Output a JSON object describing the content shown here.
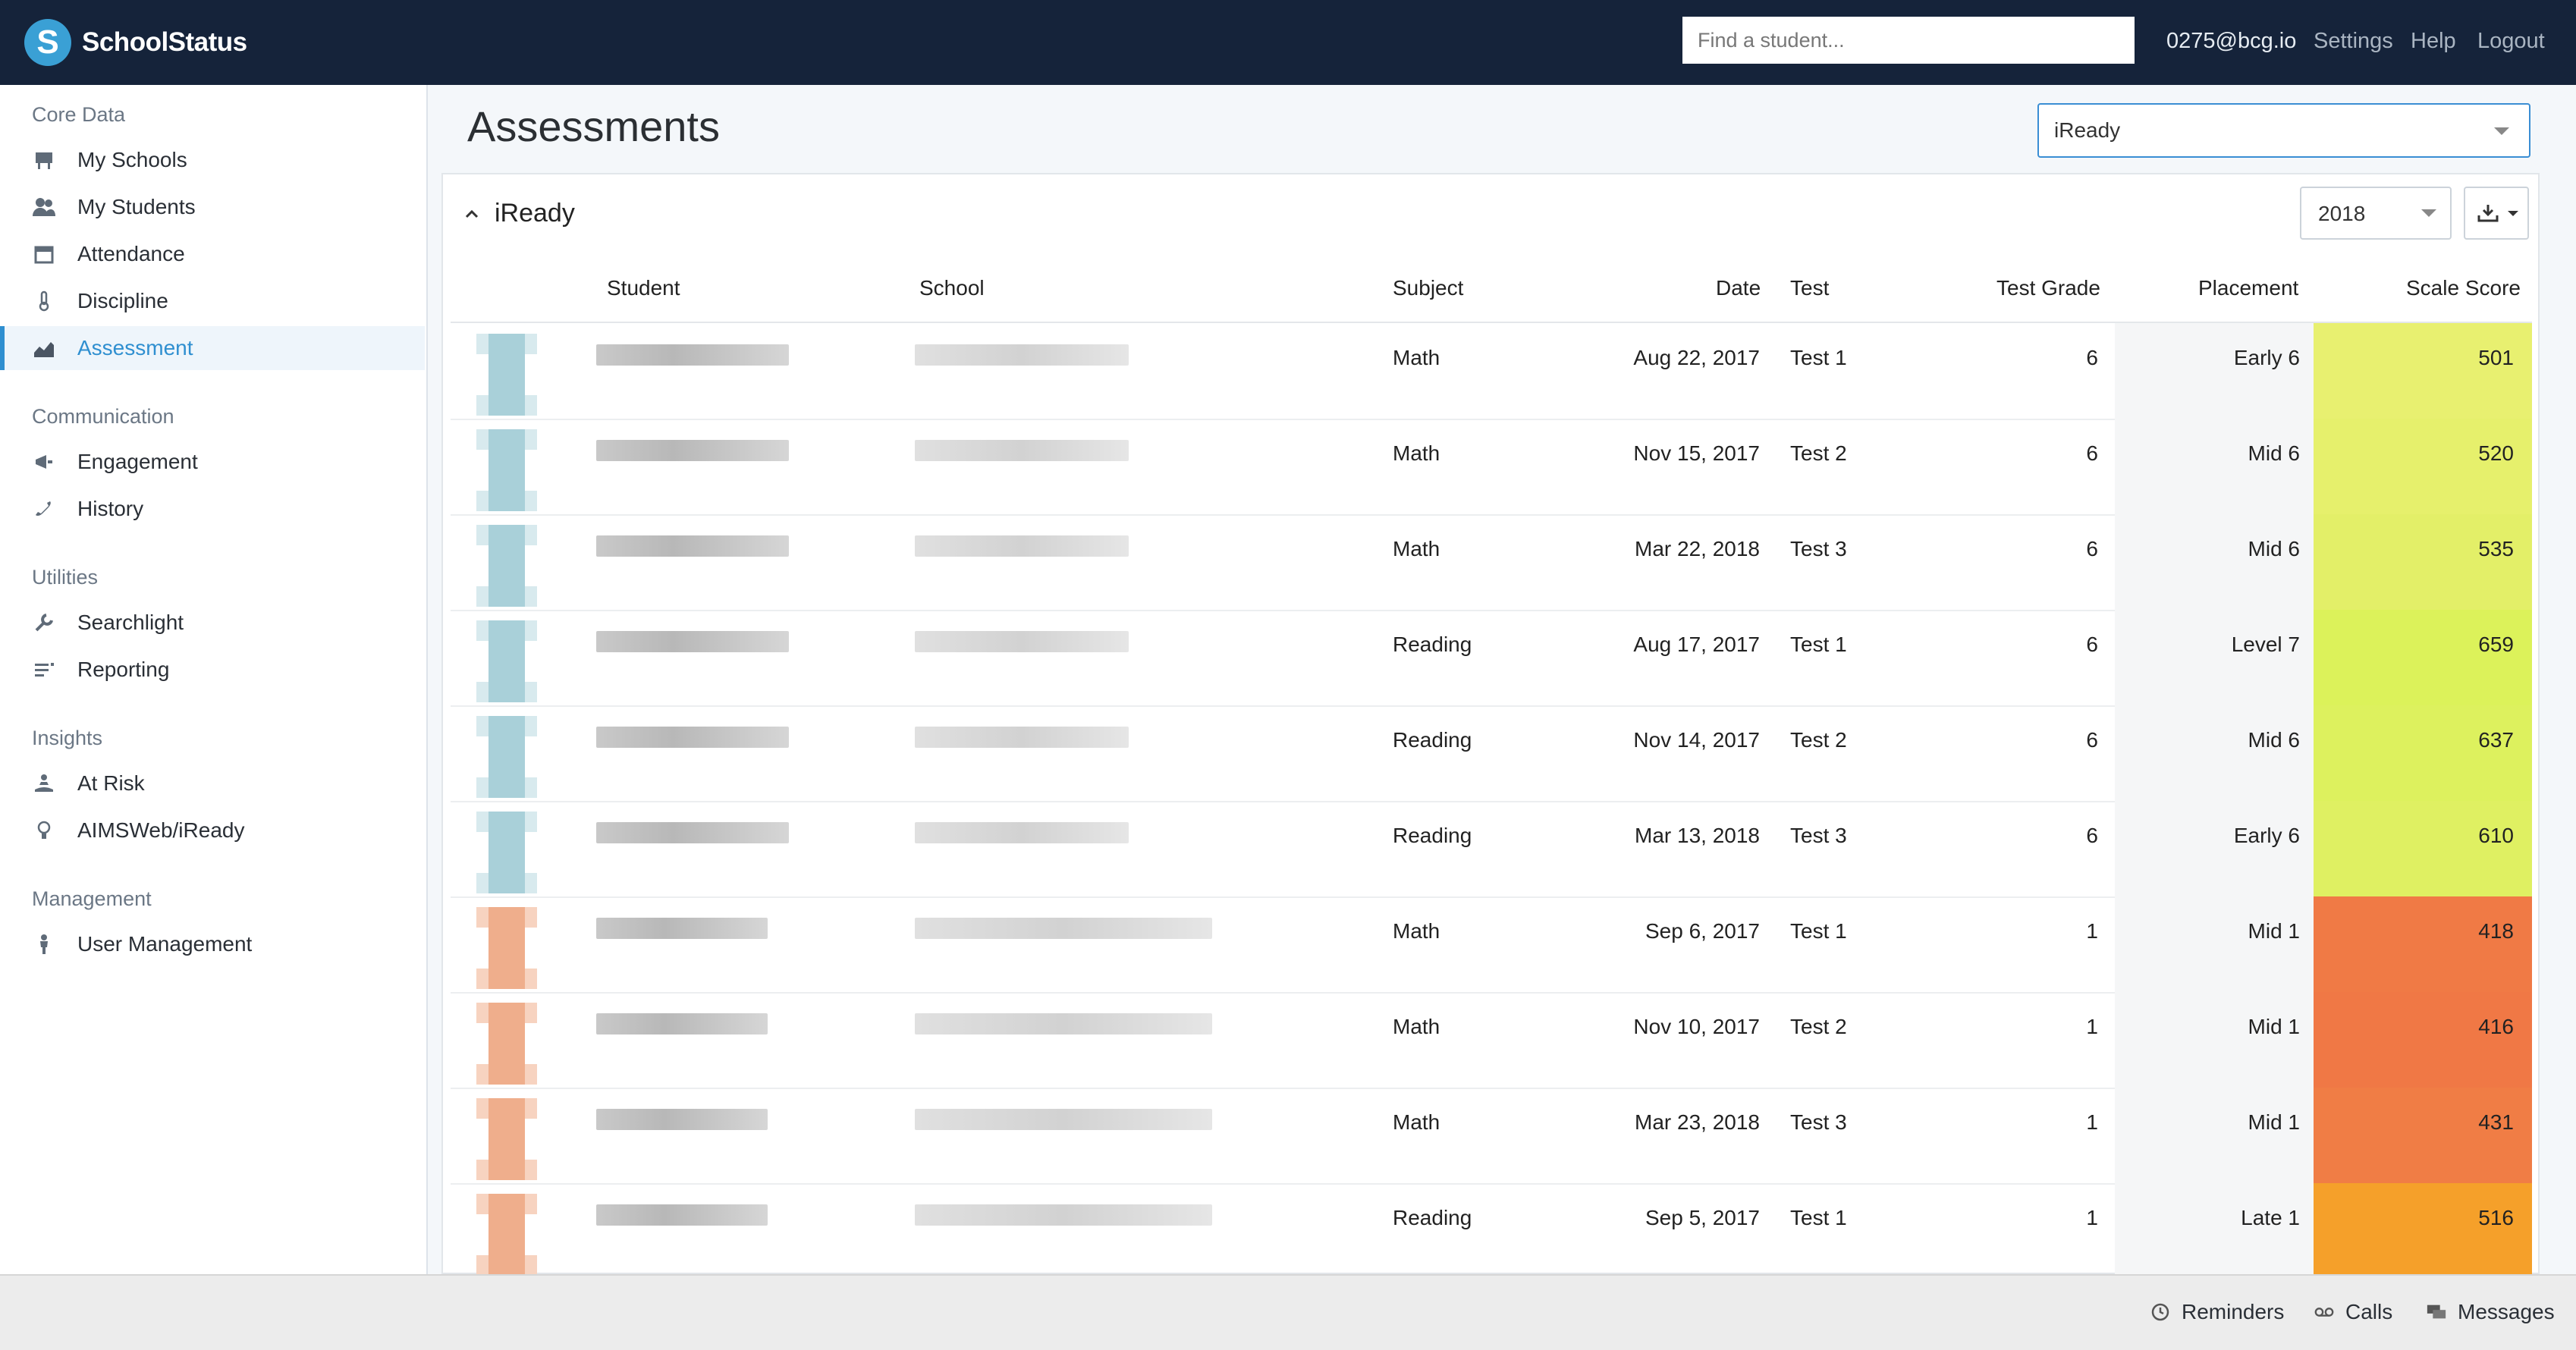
{
  "app": {
    "name": "SchoolStatus",
    "logo_letter": "S"
  },
  "topbar": {
    "search_placeholder": "Find a student...",
    "user": "0275@bcg.io",
    "settings": "Settings",
    "help": "Help",
    "logout": "Logout"
  },
  "sidebar": {
    "sections": [
      {
        "title": "Core Data",
        "items": [
          {
            "label": "My Schools",
            "icon": "school-icon"
          },
          {
            "label": "My Students",
            "icon": "students-icon"
          },
          {
            "label": "Attendance",
            "icon": "calendar-icon"
          },
          {
            "label": "Discipline",
            "icon": "thermometer-icon"
          },
          {
            "label": "Assessment",
            "icon": "chart-icon",
            "active": true
          }
        ]
      },
      {
        "title": "Communication",
        "items": [
          {
            "label": "Engagement",
            "icon": "megaphone-icon"
          },
          {
            "label": "History",
            "icon": "phone-icon"
          }
        ]
      },
      {
        "title": "Utilities",
        "items": [
          {
            "label": "Searchlight",
            "icon": "wrench-icon"
          },
          {
            "label": "Reporting",
            "icon": "list-icon"
          }
        ]
      },
      {
        "title": "Insights",
        "items": [
          {
            "label": "At Risk",
            "icon": "person-icon"
          },
          {
            "label": "AIMSWeb/iReady",
            "icon": "lightbulb-icon"
          }
        ]
      },
      {
        "title": "Management",
        "items": [
          {
            "label": "User Management",
            "icon": "user-icon"
          }
        ]
      }
    ]
  },
  "main": {
    "title": "Assessments",
    "assessment_select": "iReady",
    "panel_title": "iReady",
    "year_select": "2018"
  },
  "table": {
    "columns": [
      "Student",
      "School",
      "Subject",
      "Date",
      "Test",
      "Test Grade",
      "Placement",
      "Scale Score"
    ],
    "rows": [
      {
        "subject": "Math",
        "date": "Aug 22, 2017",
        "test": "Test 1",
        "grade": "6",
        "placement": "Early 6",
        "score": "501",
        "score_color": "#e8f070",
        "tone": "blue"
      },
      {
        "subject": "Math",
        "date": "Nov 15, 2017",
        "test": "Test 2",
        "grade": "6",
        "placement": "Mid 6",
        "score": "520",
        "score_color": "#e6f06c",
        "tone": "blue"
      },
      {
        "subject": "Math",
        "date": "Mar 22, 2018",
        "test": "Test 3",
        "grade": "6",
        "placement": "Mid 6",
        "score": "535",
        "score_color": "#e3ef68",
        "tone": "blue"
      },
      {
        "subject": "Reading",
        "date": "Aug 17, 2017",
        "test": "Test 1",
        "grade": "6",
        "placement": "Level 7",
        "score": "659",
        "score_color": "#dcf25a",
        "tone": "blue"
      },
      {
        "subject": "Reading",
        "date": "Nov 14, 2017",
        "test": "Test 2",
        "grade": "6",
        "placement": "Mid 6",
        "score": "637",
        "score_color": "#ddf15e",
        "tone": "blue"
      },
      {
        "subject": "Reading",
        "date": "Mar 13, 2018",
        "test": "Test 3",
        "grade": "6",
        "placement": "Early 6",
        "score": "610",
        "score_color": "#dff062",
        "tone": "blue"
      },
      {
        "subject": "Math",
        "date": "Sep 6, 2017",
        "test": "Test 1",
        "grade": "1",
        "placement": "Mid 1",
        "score": "418",
        "score_color": "#f07a45",
        "tone": "orange"
      },
      {
        "subject": "Math",
        "date": "Nov 10, 2017",
        "test": "Test 2",
        "grade": "1",
        "placement": "Mid 1",
        "score": "416",
        "score_color": "#f07845",
        "tone": "orange"
      },
      {
        "subject": "Math",
        "date": "Mar 23, 2018",
        "test": "Test 3",
        "grade": "1",
        "placement": "Mid 1",
        "score": "431",
        "score_color": "#f07d45",
        "tone": "orange"
      },
      {
        "subject": "Reading",
        "date": "Sep 5, 2017",
        "test": "Test 1",
        "grade": "1",
        "placement": "Late 1",
        "score": "516",
        "score_color": "#f5a02a",
        "tone": "orange"
      }
    ]
  },
  "footer": {
    "reminders": "Reminders",
    "calls": "Calls",
    "messages": "Messages"
  },
  "colors": {
    "topbar": "#15233a",
    "accent": "#2f8fd0"
  }
}
